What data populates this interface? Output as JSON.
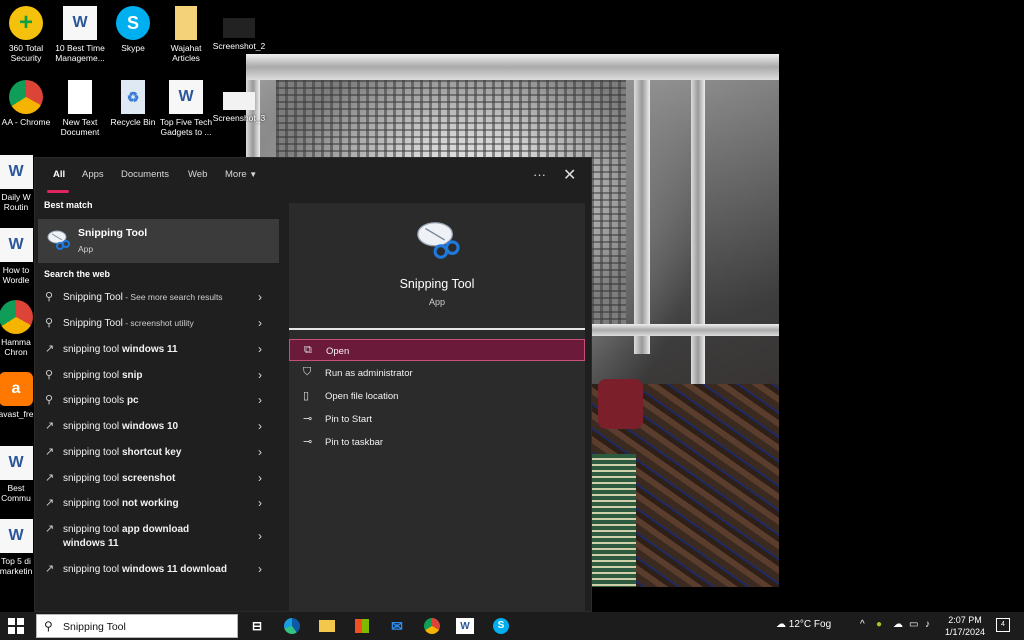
{
  "desktop": {
    "icons": [
      {
        "label": "360 Total Security",
        "icon": "360-security-icon"
      },
      {
        "label": "10 Best Time Manageme...",
        "icon": "word-doc-icon"
      },
      {
        "label": "Skype",
        "icon": "skype-icon"
      },
      {
        "label": "Wajahat Articles",
        "icon": "folder-icon"
      },
      {
        "label": "Screenshot_2",
        "icon": "image-icon"
      },
      {
        "label": "AA - Chrome",
        "icon": "chrome-icon"
      },
      {
        "label": "New Text Document",
        "icon": "text-doc-icon"
      },
      {
        "label": "Recycle Bin",
        "icon": "recycle-bin-icon"
      },
      {
        "label": "Top Five Tech Gadgets to ...",
        "icon": "word-doc-icon"
      },
      {
        "label": "Screenshot_3",
        "icon": "image-icon"
      },
      {
        "label": "Daily W Routin",
        "icon": "word-doc-icon"
      },
      {
        "label": "How to Wordle",
        "icon": "word-doc-icon"
      },
      {
        "label": "Hamma Chron",
        "icon": "chrome-icon"
      },
      {
        "label": "avast_fre",
        "icon": "avast-icon"
      },
      {
        "label": "Best Commu",
        "icon": "word-doc-icon"
      },
      {
        "label": "Top 5 di marketin",
        "icon": "word-doc-icon"
      }
    ]
  },
  "flyout": {
    "tabs": [
      "All",
      "Apps",
      "Documents",
      "Web",
      "More"
    ],
    "active_tab": "All",
    "more_dots": "···",
    "close": "✕",
    "best_match_heading": "Best match",
    "best_match": {
      "title": "Snipping Tool",
      "subtitle": "App"
    },
    "web_heading": "Search the web",
    "web_results": [
      {
        "prefix": "Snipping Tool",
        "bold": "",
        "suffix": " - See more search results",
        "icon": "search-icon"
      },
      {
        "prefix": "Snipping Tool",
        "bold": "",
        "suffix": " - screenshot utility",
        "icon": "search-icon"
      },
      {
        "prefix": "snipping tool ",
        "bold": "windows 11",
        "suffix": "",
        "icon": "trending-icon"
      },
      {
        "prefix": "snipping tool ",
        "bold": "snip",
        "suffix": "",
        "icon": "search-icon"
      },
      {
        "prefix": "snipping tools ",
        "bold": "pc",
        "suffix": "",
        "icon": "search-icon"
      },
      {
        "prefix": "snipping tool ",
        "bold": "windows 10",
        "suffix": "",
        "icon": "trending-icon"
      },
      {
        "prefix": "snipping tool ",
        "bold": "shortcut key",
        "suffix": "",
        "icon": "trending-icon"
      },
      {
        "prefix": "snipping tool ",
        "bold": "screenshot",
        "suffix": "",
        "icon": "trending-icon"
      },
      {
        "prefix": "snipping tool ",
        "bold": "not working",
        "suffix": "",
        "icon": "trending-icon"
      },
      {
        "prefix": "snipping tool ",
        "bold": "app download windows 11",
        "suffix": "",
        "icon": "trending-icon"
      },
      {
        "prefix": "snipping tool ",
        "bold": "windows 11 download",
        "suffix": "",
        "icon": "trending-icon"
      }
    ],
    "detail": {
      "title": "Snipping Tool",
      "subtitle": "App",
      "actions": [
        {
          "label": "Open",
          "icon": "open-icon"
        },
        {
          "label": "Run as administrator",
          "icon": "shield-icon"
        },
        {
          "label": "Open file location",
          "icon": "file-location-icon"
        },
        {
          "label": "Pin to Start",
          "icon": "pin-icon"
        },
        {
          "label": "Pin to taskbar",
          "icon": "pin-icon"
        }
      ]
    }
  },
  "taskbar": {
    "search_value": "Snipping Tool",
    "weather": "12°C  Fog",
    "time": "2:07 PM",
    "date": "1/17/2024",
    "notification_count": "4"
  }
}
